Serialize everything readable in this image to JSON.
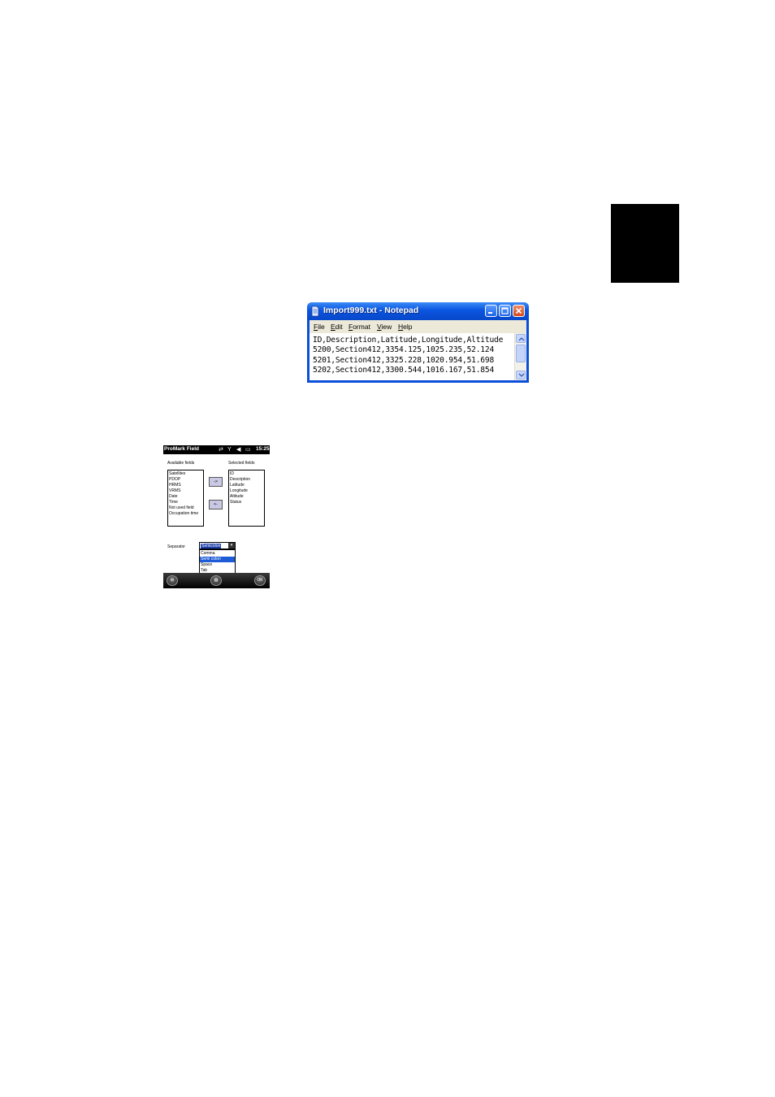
{
  "notepad": {
    "title": "Import999.txt - Notepad",
    "menu": [
      "File",
      "Edit",
      "Format",
      "View",
      "Help"
    ],
    "lines": [
      "ID,Description,Latitude,Longitude,Altitude",
      "5200,Section412,3354.125,1025.235,52.124",
      "5201,Section412,3325.228,1020.954,51.698",
      "5202,Section412,3300.544,1016.167,51.854"
    ]
  },
  "device": {
    "app_title": "ProMark Field",
    "clock": "15:25",
    "available_label": "Available fields",
    "selected_label": "Selected fields",
    "available_fields": [
      "Satellites",
      "PDOP",
      "HRMS",
      "VRMS",
      "Date",
      "Time",
      "Not used field",
      "Occupation time"
    ],
    "selected_fields": [
      "ID",
      "Description",
      "Latitude",
      "Longitude",
      "Altitude",
      "Status"
    ],
    "add_label": "->",
    "remove_label": "<-",
    "separator_label": "Separator",
    "separator_value": "Semicolon",
    "separator_options": [
      "Comma",
      "Semi colon",
      "Space",
      "Tab"
    ],
    "ok_label": "OK"
  }
}
